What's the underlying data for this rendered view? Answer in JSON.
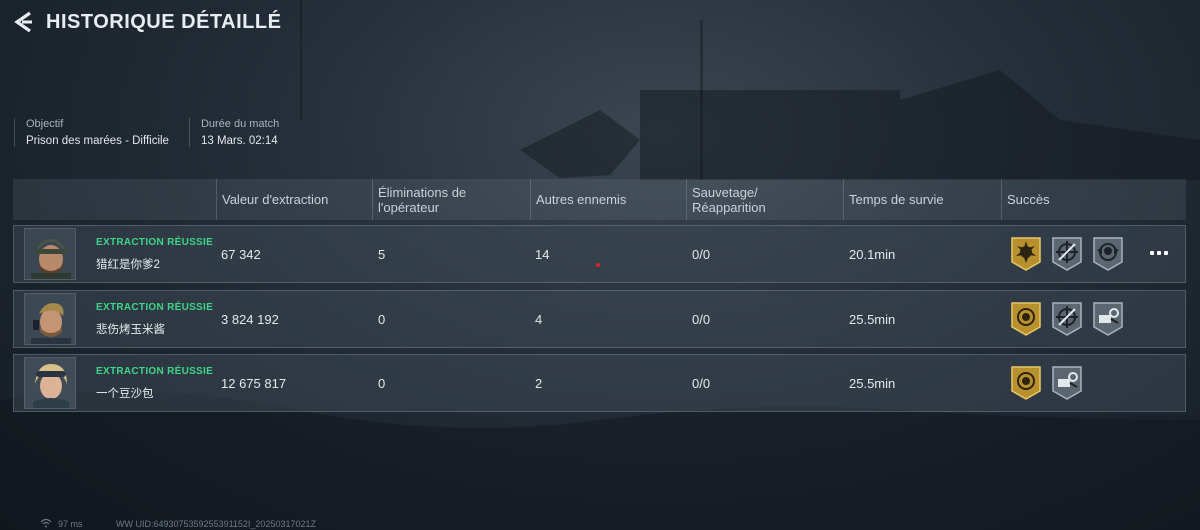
{
  "header": {
    "title": "HISTORIQUE DÉTAILLÉ",
    "back_icon": "back-arrow-icon"
  },
  "meta": [
    {
      "label": "Objectif",
      "value": "Prison des marées - Difficile"
    },
    {
      "label": "Durée du match",
      "value": "13 Mars. 02:14"
    }
  ],
  "table": {
    "columns": [
      {
        "lines": [
          "Valeur d'extraction"
        ]
      },
      {
        "lines": [
          "Éliminations de",
          "l'opérateur"
        ]
      },
      {
        "lines": [
          "Autres ennemis"
        ]
      },
      {
        "lines": [
          "Sauvetage/",
          "Réapparition"
        ]
      },
      {
        "lines": [
          "Temps de survie"
        ]
      },
      {
        "lines": [
          "Succès"
        ]
      }
    ],
    "rows": [
      {
        "status": "EXTRACTION RÉUSSIE",
        "player": "猎红是你爹2",
        "extraction_value": "67 342",
        "operator_kills": "5",
        "other_enemies": "14",
        "rescue_respawn": "0/0",
        "survival_time": "20.1min",
        "badges": [
          "gold-sun-badge-icon",
          "crosshair-badge-icon",
          "skull-wings-badge-icon"
        ],
        "has_more": true
      },
      {
        "status": "EXTRACTION RÉUSSIE",
        "player": "悲伤烤玉米酱",
        "extraction_value": "3 824 192",
        "operator_kills": "0",
        "other_enemies": "4",
        "rescue_respawn": "0/0",
        "survival_time": "25.5min",
        "badges": [
          "gold-emblem-badge-icon",
          "crosshair-badge-icon",
          "gear-hand-badge-icon"
        ],
        "has_more": false
      },
      {
        "status": "EXTRACTION RÉUSSIE",
        "player": "一个豆沙包",
        "extraction_value": "12 675 817",
        "operator_kills": "0",
        "other_enemies": "2",
        "rescue_respawn": "0/0",
        "survival_time": "25.5min",
        "badges": [
          "gold-emblem-badge-icon",
          "gear-hand-badge-icon"
        ],
        "has_more": false
      }
    ]
  },
  "footer": {
    "ping": "97 ms",
    "uid": "WW UID:6493075359255391152I_20250317021Z"
  },
  "colors": {
    "success_green": "#3fd48a",
    "gold_badge": "#b8912e",
    "grey_badge": "#5c6670",
    "accent_red": "#d8262e"
  }
}
